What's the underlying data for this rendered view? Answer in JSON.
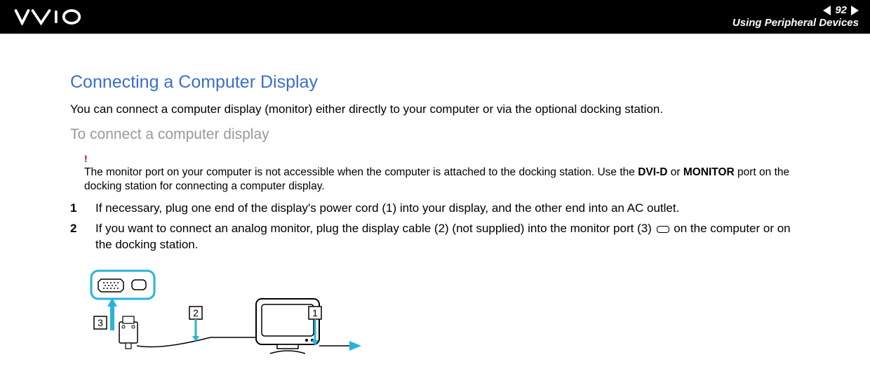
{
  "header": {
    "page_number": "92",
    "section": "Using Peripheral Devices"
  },
  "title": "Connecting a Computer Display",
  "intro": "You can connect a computer display (monitor) either directly to your computer or via the optional docking station.",
  "subheading": "To connect a computer display",
  "note": {
    "bang": "!",
    "text_before": "The monitor port on your computer is not accessible when the computer is attached to the docking station. Use the ",
    "bold_a": "DVI-D",
    "text_mid": " or ",
    "bold_b": "MONITOR",
    "text_after": " port on the docking station for connecting a computer display."
  },
  "steps": [
    {
      "num": "1",
      "text": "If necessary, plug one end of the display's power cord (1) into your display, and the other end into an AC outlet."
    },
    {
      "num": "2",
      "text_a": "If you want to connect an analog monitor, plug the display cable (2) (not supplied) into the monitor port (3) ",
      "text_b": " on the computer or on the docking station."
    }
  ],
  "diagram_labels": {
    "a": "3",
    "b": "2",
    "c": "1"
  }
}
